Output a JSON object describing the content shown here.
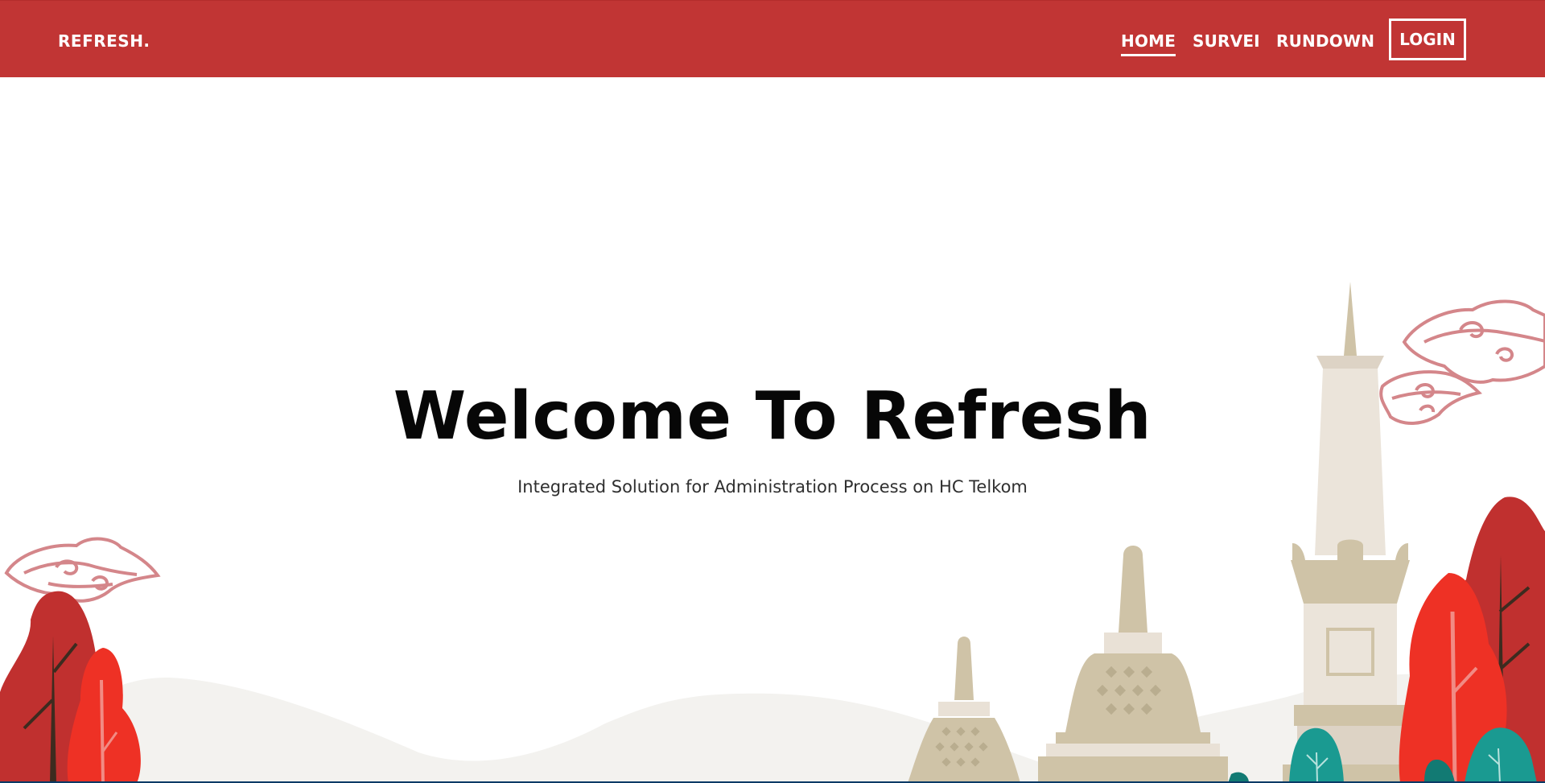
{
  "brand": "REFRESH.",
  "nav": {
    "home": "HOME",
    "survei": "SURVEI",
    "rundown": "RUNDOWN",
    "login": "LOGIN"
  },
  "hero": {
    "title": "Welcome To Refresh",
    "subtitle": "Integrated Solution for Administration Process on HC Telkom"
  },
  "colors": {
    "brand_red": "#c13534",
    "cloud_pink": "#d4868a",
    "temple_beige": "#cfc3a7",
    "tree_red": "#c0302f",
    "tree_bright_red": "#ee3125",
    "tree_teal": "#1a9a91"
  }
}
